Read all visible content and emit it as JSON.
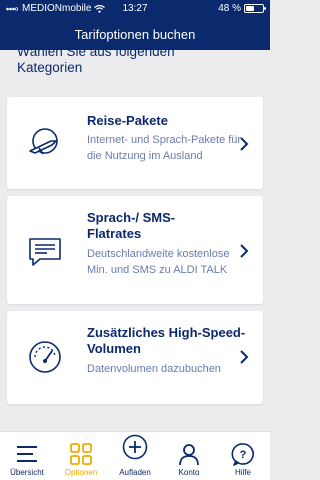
{
  "status": {
    "carrier": "MEDIONmobile",
    "time": "13:27",
    "battery": "48 %",
    "battery_level": 0.48
  },
  "navbar": {
    "title": "Tarifoptionen buchen"
  },
  "section": {
    "line1": "Wählen Sie aus folgenden",
    "line2": "Kategorien"
  },
  "cards": [
    {
      "title": "Reise-Pakete",
      "desc": "Internet- und Sprach-Pakete für die Nutzung im Ausland",
      "icon": "globe-plane-icon"
    },
    {
      "title": "Sprach-/ SMS-Flatrates",
      "desc": "Deutschlandweite kostenlose Min. und SMS zu ALDI TALK",
      "icon": "chat-bubble-icon"
    },
    {
      "title": "Zusätzliches High-Speed-Volumen",
      "desc": "Datenvolumen dazubuchen",
      "icon": "speedometer-icon"
    }
  ],
  "tabs": [
    {
      "label": "Übersicht",
      "icon": "menu-lines-icon",
      "active": false
    },
    {
      "label": "Optionen",
      "icon": "grid-icon",
      "active": true
    },
    {
      "label": "Aufladen",
      "icon": "plus-circle-icon",
      "active": false
    },
    {
      "label": "Konto",
      "icon": "person-icon",
      "active": false
    },
    {
      "label": "Hilfe",
      "icon": "help-icon",
      "active": false
    }
  ],
  "colors": {
    "brand": "#0b2a6d",
    "accent": "#f2a900",
    "muted": "#6c7bb0"
  }
}
